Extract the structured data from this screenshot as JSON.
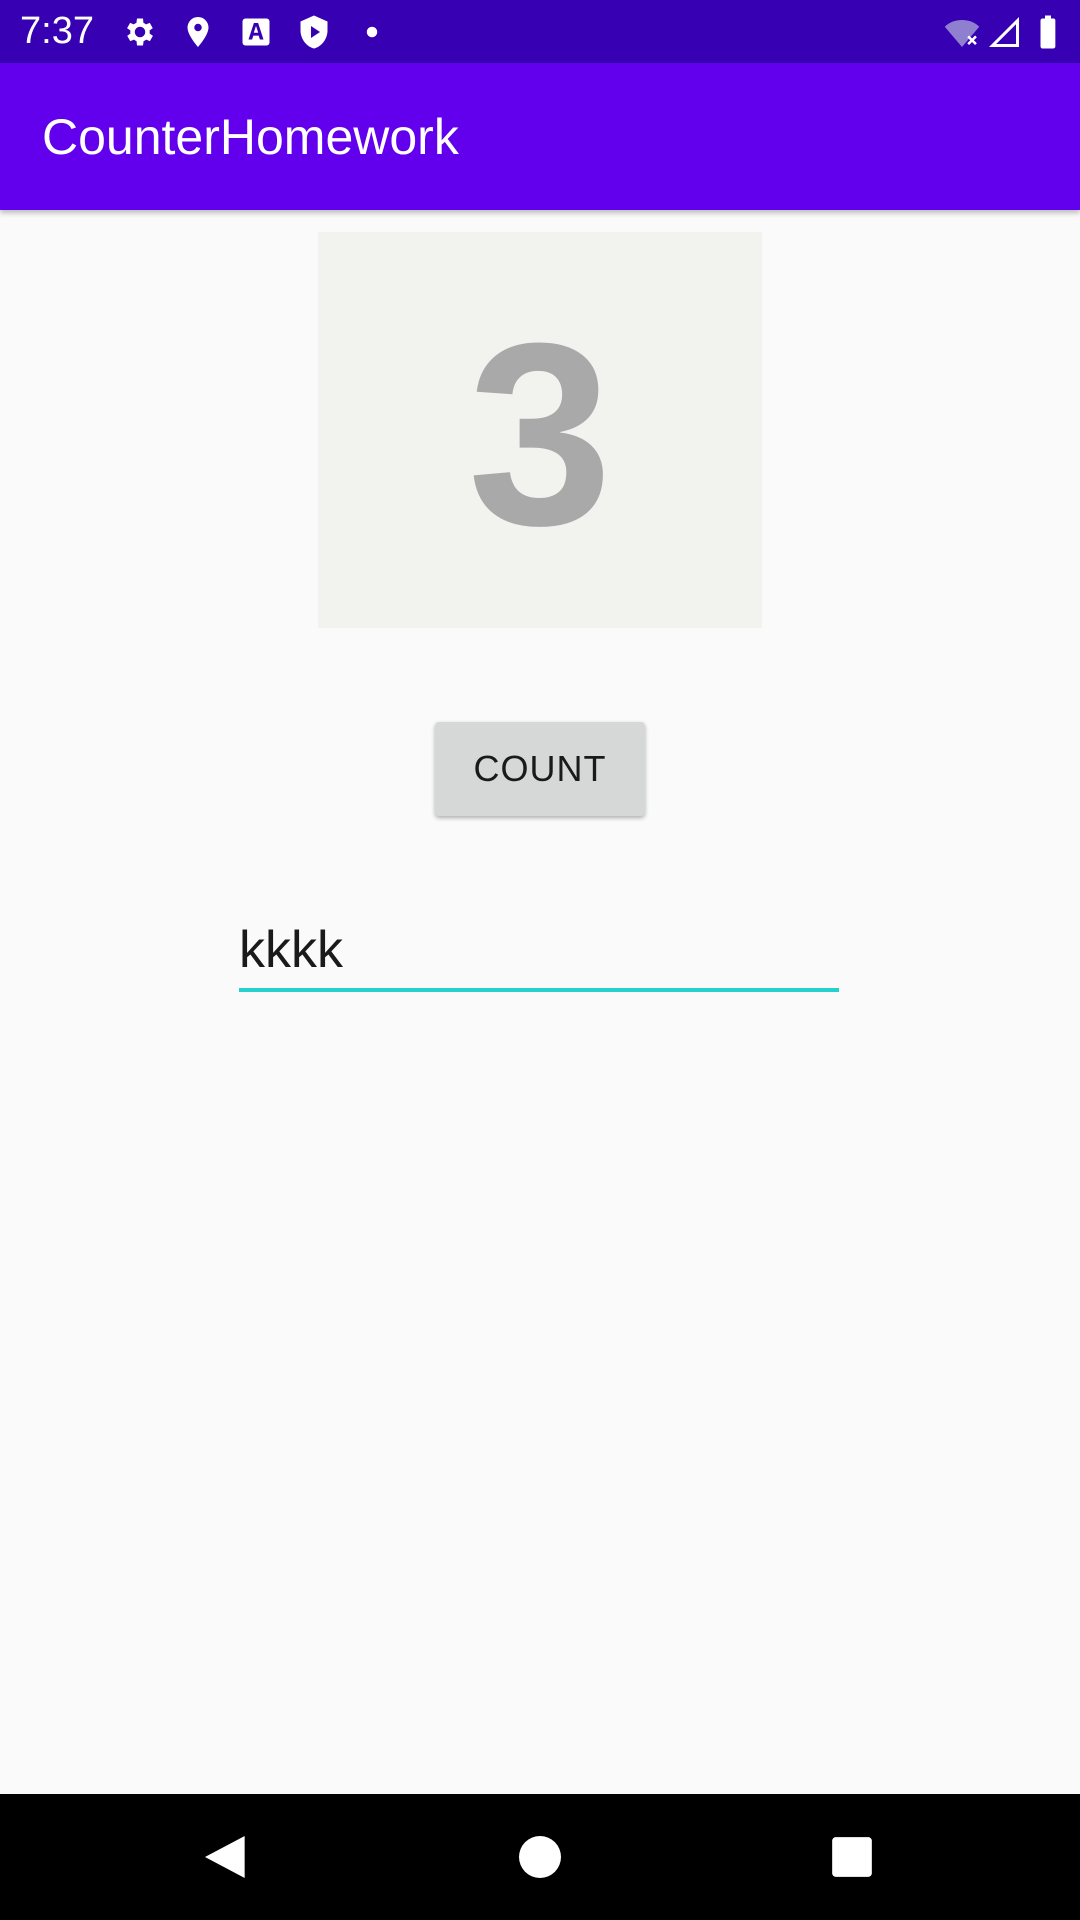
{
  "status_bar": {
    "time": "7:37",
    "icons_left": [
      "gear-icon",
      "location-pin-icon",
      "font-download-icon",
      "play-shield-icon",
      "dot-icon"
    ],
    "icons_right": [
      "wifi-off-icon",
      "cell-signal-icon",
      "battery-icon"
    ],
    "background": "#3700b3"
  },
  "app_bar": {
    "title": "CounterHomework",
    "background": "#6200ee"
  },
  "counter": {
    "value": "3"
  },
  "count_button": {
    "label": "COUNT"
  },
  "text_field": {
    "value": "kkkk",
    "accent": "#26d0ce"
  },
  "nav_bar": {
    "icons": [
      "back-icon",
      "home-icon",
      "recents-icon"
    ]
  }
}
